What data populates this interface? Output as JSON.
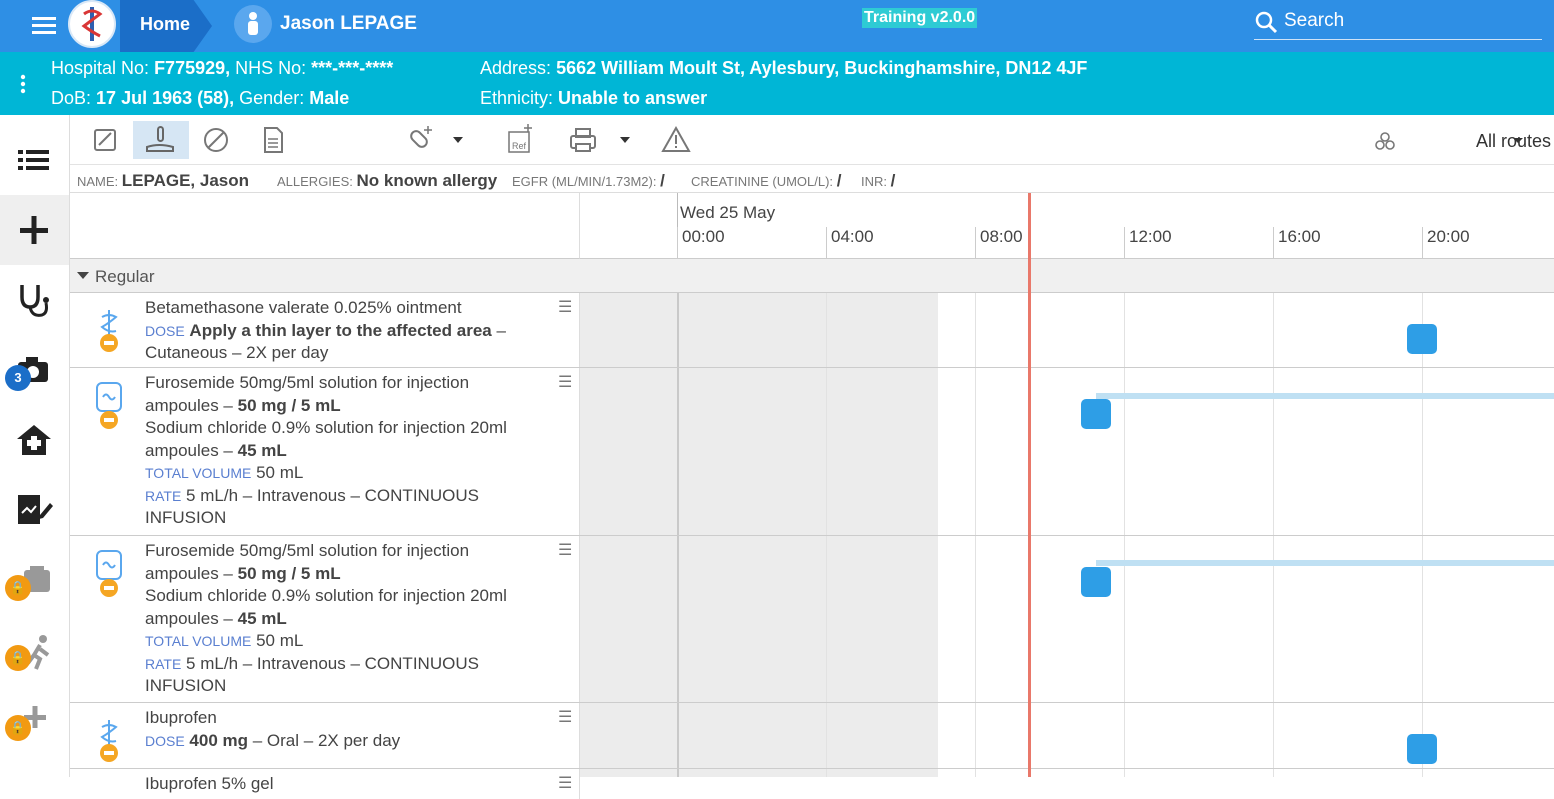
{
  "header": {
    "home": "Home",
    "patient": "Jason LEPAGE",
    "training": "Training v2.0.0",
    "search": "Search"
  },
  "infobar": {
    "hosp_label": "Hospital No:",
    "hosp": "F775929,",
    "nhs_label": "NHS No:",
    "nhs": "***-***-****",
    "dob_label": "DoB:",
    "dob": "17 Jul 1963 (58),",
    "gender_label": "Gender:",
    "gender": "Male",
    "addr_label": "Address:",
    "addr": "5662 William Moult St, Aylesbury, Buckinghamshire, DN12 4JF",
    "eth_label": "Ethnicity:",
    "eth": "Unable to answer"
  },
  "nav": {
    "camera_badge": "3"
  },
  "toolbar": {
    "routes": "All routes"
  },
  "ptinfo": {
    "name_label": "NAME:",
    "name": "LEPAGE, Jason",
    "allergy_label": "ALLERGIES:",
    "allergy": "No known allergy",
    "egfr_label": "EGFR (ML/MIN/1.73M2):",
    "egfr": "/",
    "creat_label": "CREATININE (UMOL/L):",
    "creat": "/",
    "inr_label": "INR:",
    "inr": "/"
  },
  "timeline": {
    "date": "Wed 25 May",
    "ticks": [
      "00:00",
      "04:00",
      "08:00",
      "12:00",
      "16:00",
      "20:00"
    ]
  },
  "group": {
    "label": "Regular"
  },
  "rows": [
    {
      "l1": "Betamethasone valerate 0.025% ointment",
      "dose_label": "DOSE",
      "dose": "Apply a thin layer to the affected area",
      "l3": "– Cutaneous – 2X per day",
      "sep": "–"
    },
    {
      "l1": "Furosemide 50mg/5ml solution for injection",
      "l2a": "ampoules –",
      "l2b": "50 mg / 5 mL",
      "l3": "Sodium chloride 0.9% solution for injection 20ml",
      "l4a": "ampoules –",
      "l4b": "45 mL",
      "tv_label": "TOTAL VOLUME",
      "tv": "50 mL",
      "rate_label": "RATE",
      "rate": "5 mL/h – Intravenous – CONTINUOUS",
      "l7": "INFUSION"
    },
    {
      "l1": "Furosemide 50mg/5ml solution for injection",
      "l2a": "ampoules –",
      "l2b": "50 mg / 5 mL",
      "l3": "Sodium chloride 0.9% solution for injection 20ml",
      "l4a": "ampoules –",
      "l4b": "45 mL",
      "tv_label": "TOTAL VOLUME",
      "tv": "50 mL",
      "rate_label": "RATE",
      "rate": "5 mL/h – Intravenous – CONTINUOUS",
      "l7": "INFUSION"
    },
    {
      "l1": "Ibuprofen",
      "dose_label": "DOSE",
      "dose": "400 mg",
      "l3": "– Oral – 2X per day"
    },
    {
      "l1": "Ibuprofen 5% gel"
    }
  ],
  "menu_glyph": "☰"
}
